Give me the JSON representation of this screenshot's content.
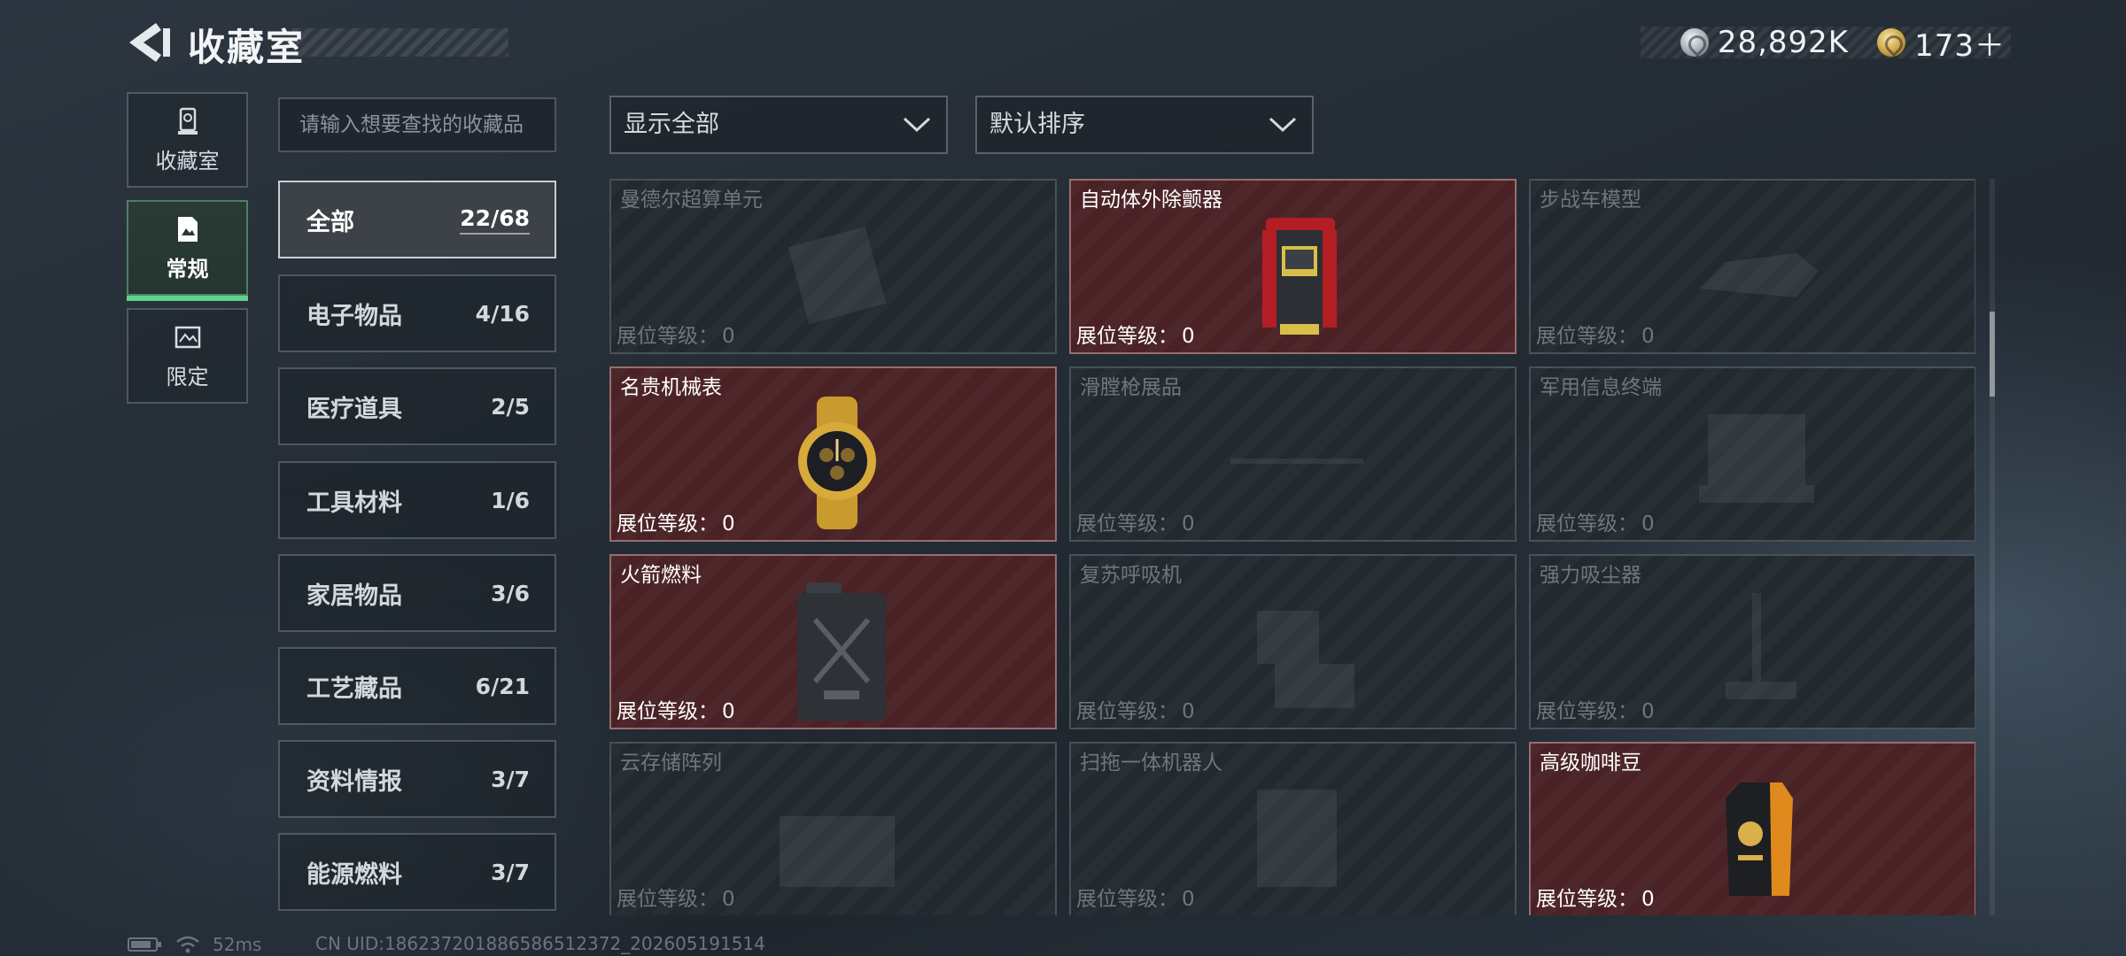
{
  "header": {
    "title": "收藏室",
    "currencies": [
      {
        "icon": "silver-coin-icon",
        "value": "28,892K"
      },
      {
        "icon": "gold-coin-icon",
        "value": "173＋"
      }
    ]
  },
  "side_tabs": [
    {
      "label": "收藏室",
      "icon": "trophy-icon",
      "active": false
    },
    {
      "label": "常规",
      "icon": "document-icon",
      "active": true
    },
    {
      "label": "限定",
      "icon": "picture-icon",
      "active": false
    }
  ],
  "search": {
    "placeholder": "请输入想要查找的收藏品"
  },
  "categories": [
    {
      "label": "全部",
      "count": "22/68",
      "active": true
    },
    {
      "label": "电子物品",
      "count": "4/16"
    },
    {
      "label": "医疗道具",
      "count": "2/5"
    },
    {
      "label": "工具材料",
      "count": "1/6"
    },
    {
      "label": "家居物品",
      "count": "3/6"
    },
    {
      "label": "工艺藏品",
      "count": "6/21"
    },
    {
      "label": "资料情报",
      "count": "3/7"
    },
    {
      "label": "能源燃料",
      "count": "3/7"
    }
  ],
  "filters": {
    "show": "显示全部",
    "sort": "默认排序"
  },
  "level_label": "展位等级：",
  "items": [
    {
      "name": "曼德尔超算单元",
      "level": "0",
      "owned": false,
      "icon": "supercomputer-icon"
    },
    {
      "name": "自动体外除颤器",
      "level": "0",
      "owned": true,
      "icon": "defibrillator-icon"
    },
    {
      "name": "步战车模型",
      "level": "0",
      "owned": false,
      "icon": "ifv-model-icon"
    },
    {
      "name": "名贵机械表",
      "level": "0",
      "owned": true,
      "icon": "watch-icon"
    },
    {
      "name": "滑膛枪展品",
      "level": "0",
      "owned": false,
      "icon": "musket-icon"
    },
    {
      "name": "军用信息终端",
      "level": "0",
      "owned": false,
      "icon": "terminal-icon"
    },
    {
      "name": "火箭燃料",
      "level": "0",
      "owned": true,
      "icon": "jerrycan-icon"
    },
    {
      "name": "复苏呼吸机",
      "level": "0",
      "owned": false,
      "icon": "ventilator-icon"
    },
    {
      "name": "强力吸尘器",
      "level": "0",
      "owned": false,
      "icon": "vacuum-icon"
    },
    {
      "name": "云存储阵列",
      "level": "0",
      "owned": false,
      "icon": "storage-array-icon"
    },
    {
      "name": "扫拖一体机器人",
      "level": "0",
      "owned": false,
      "icon": "robot-vacuum-icon"
    },
    {
      "name": "高级咖啡豆",
      "level": "0",
      "owned": true,
      "icon": "coffee-bag-icon"
    }
  ],
  "footer": {
    "ping": "52ms",
    "uid": "CN UID:1862372018865865123​72_202605191514"
  },
  "colors": {
    "owned_card": "#4a2226",
    "empty_card": "#22292f",
    "active_tab_accent": "#5fd38c"
  }
}
